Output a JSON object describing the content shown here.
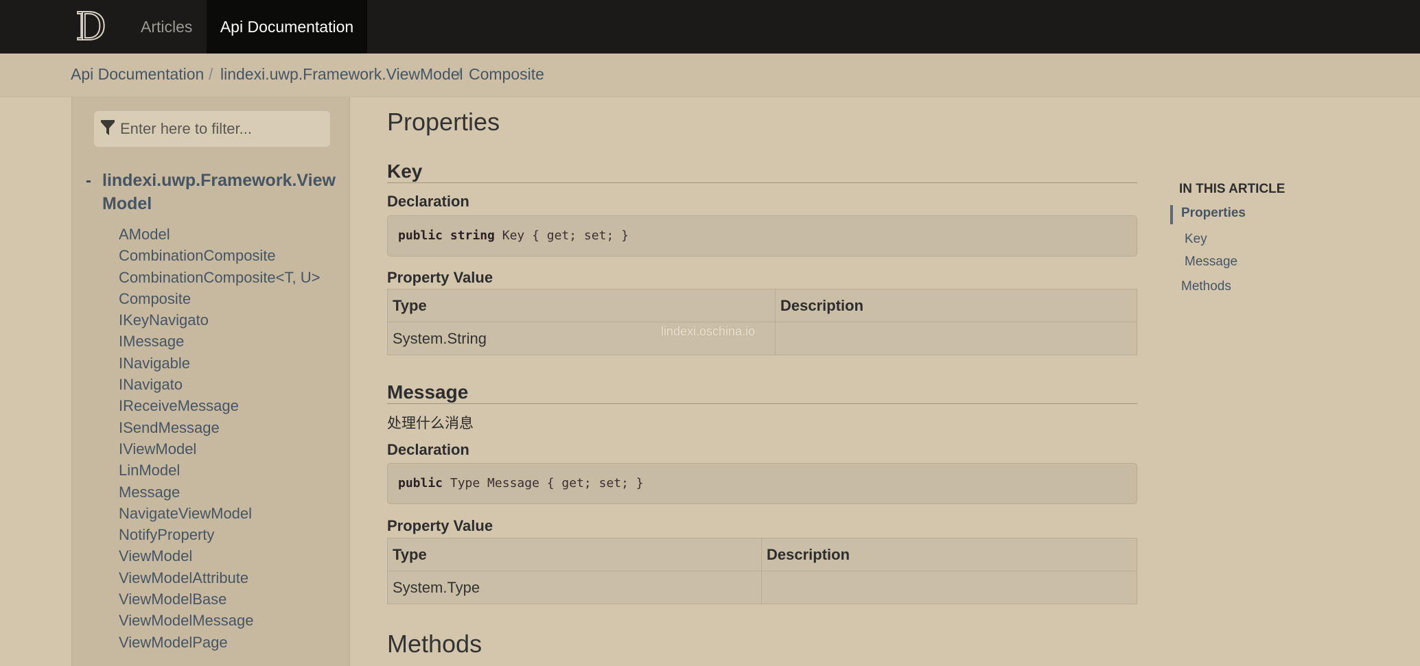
{
  "nav": {
    "logo_letter": "D",
    "articles": "Articles",
    "api_docs": "Api Documentation"
  },
  "breadcrumb": {
    "items": [
      "Api Documentation",
      "lindexi.uwp.Framework.ViewModel",
      "Composite"
    ],
    "separator": "/"
  },
  "sidebar": {
    "filter_placeholder": "Enter here to filter...",
    "namespace_toggle": "-",
    "namespace_line1": "lindexi.uwp.Framework.View",
    "namespace_line2": "Model",
    "items": [
      "AModel",
      "CombinationComposite",
      "CombinationComposite<T, U>",
      "Composite",
      "IKeyNavigato",
      "IMessage",
      "INavigable",
      "INavigato",
      "IReceiveMessage",
      "ISendMessage",
      "IViewModel",
      "LinModel",
      "Message",
      "NavigateViewModel",
      "NotifyProperty",
      "ViewModel",
      "ViewModelAttribute",
      "ViewModelBase",
      "ViewModelMessage",
      "ViewModelPage"
    ]
  },
  "main": {
    "properties_heading": "Properties",
    "key": {
      "name": "Key",
      "declaration_label": "Declaration",
      "code_keywords": "public string",
      "code_rest": " Key { get; set; }",
      "property_value_label": "Property Value",
      "col_type": "Type",
      "col_description": "Description",
      "type_value": "System.String",
      "description_value": ""
    },
    "message": {
      "name": "Message",
      "summary": "处理什么消息",
      "declaration_label": "Declaration",
      "code_keywords": "public",
      "code_rest": " Type Message { get; set; }",
      "property_value_label": "Property Value",
      "col_type": "Type",
      "col_description": "Description",
      "type_value": "System.Type",
      "description_value": ""
    },
    "methods_heading": "Methods",
    "watermark": "lindexi.oschina.io"
  },
  "affix": {
    "title": "IN THIS ARTICLE",
    "links": {
      "properties": "Properties",
      "key": "Key",
      "message": "Message",
      "methods": "Methods"
    }
  },
  "colors": {
    "page_bg": "#d3c6ad",
    "topnav_bg": "#1b1a18",
    "sidebar_bg": "#c7b99f",
    "link": "#455564"
  }
}
